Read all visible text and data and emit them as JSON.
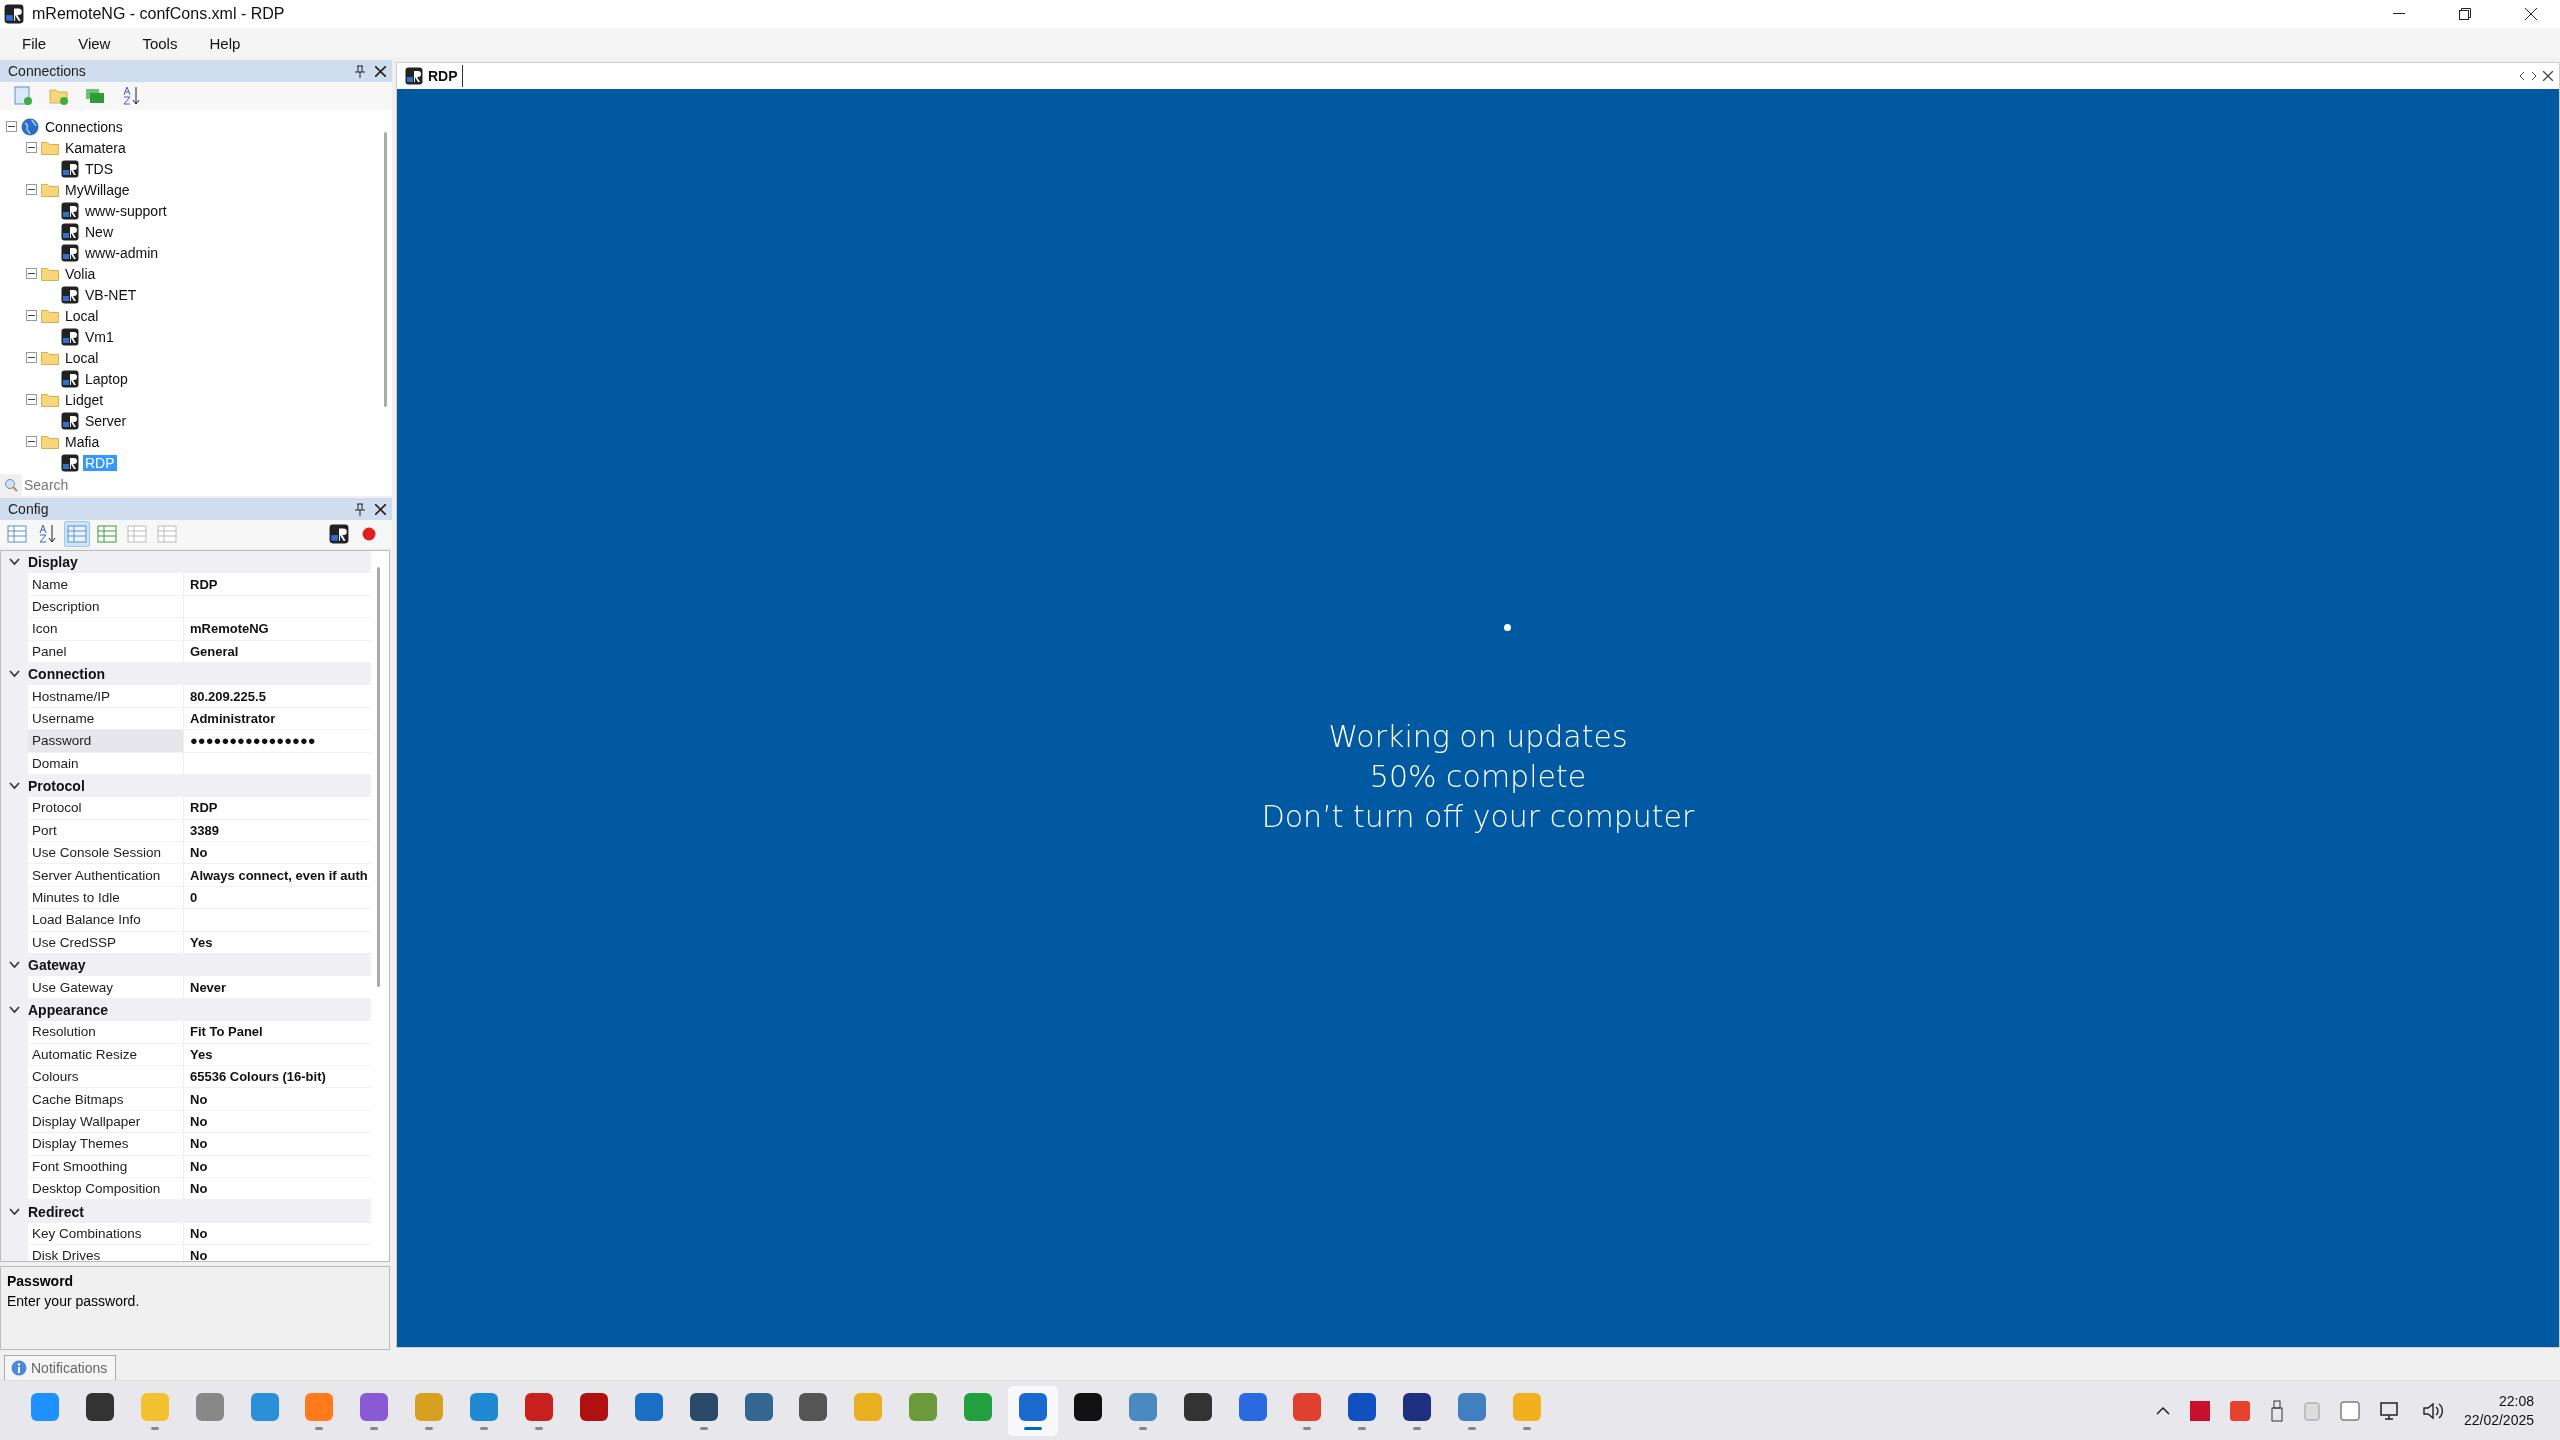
{
  "window": {
    "title": "mRemoteNG - confCons.xml - RDP"
  },
  "menu": [
    "File",
    "View",
    "Tools",
    "Help"
  ],
  "connections_panel": {
    "title": "Connections",
    "search_placeholder": "Search",
    "tree": [
      {
        "label": "Connections",
        "kind": "root",
        "expanded": true,
        "selected": false,
        "children": [
          {
            "label": "Kamatera",
            "kind": "folder",
            "expanded": true,
            "selected": false,
            "children": [
              {
                "label": "TDS",
                "kind": "connection",
                "selected": false
              }
            ]
          },
          {
            "label": "MyWillage",
            "kind": "folder",
            "expanded": true,
            "selected": false,
            "children": [
              {
                "label": "www-support",
                "kind": "connection",
                "selected": false
              },
              {
                "label": "New",
                "kind": "connection",
                "selected": false
              },
              {
                "label": "www-admin",
                "kind": "connection",
                "selected": false
              }
            ]
          },
          {
            "label": "Volia",
            "kind": "folder",
            "expanded": true,
            "selected": false,
            "children": [
              {
                "label": "VB-NET",
                "kind": "connection",
                "selected": false
              }
            ]
          },
          {
            "label": "Local",
            "kind": "folder",
            "expanded": true,
            "selected": false,
            "children": [
              {
                "label": "Vm1",
                "kind": "connection",
                "selected": false
              }
            ]
          },
          {
            "label": "Local",
            "kind": "folder",
            "expanded": true,
            "selected": false,
            "children": [
              {
                "label": "Laptop",
                "kind": "connection",
                "selected": false
              }
            ]
          },
          {
            "label": "Lidget",
            "kind": "folder",
            "expanded": true,
            "selected": false,
            "children": [
              {
                "label": "Server",
                "kind": "connection",
                "selected": false
              }
            ]
          },
          {
            "label": "Mafia",
            "kind": "folder",
            "expanded": true,
            "selected": false,
            "children": [
              {
                "label": "RDP",
                "kind": "connection",
                "selected": true
              }
            ]
          }
        ]
      }
    ]
  },
  "config_panel": {
    "title": "Config",
    "toolbar": [
      {
        "selected": false,
        "disabled": false
      },
      {
        "selected": false,
        "disabled": false
      },
      {
        "selected": true,
        "disabled": false
      },
      {
        "selected": false,
        "disabled": false
      },
      {
        "selected": false,
        "disabled": true
      },
      {
        "selected": false,
        "disabled": true
      }
    ],
    "categories": [
      {
        "name": "Display",
        "expanded": true,
        "properties": [
          {
            "name": "Name",
            "value": "RDP",
            "selected": false
          },
          {
            "name": "Description",
            "selected": false
          },
          {
            "name": "Icon",
            "value": "mRemoteNG",
            "selected": false
          },
          {
            "name": "Panel",
            "value": "General",
            "selected": false
          }
        ]
      },
      {
        "name": "Connection",
        "expanded": true,
        "properties": [
          {
            "name": "Hostname/IP",
            "value": "80.209.225.5",
            "selected": false
          },
          {
            "name": "Username",
            "value": "Administrator",
            "selected": false
          },
          {
            "name": "Password",
            "value": "●●●●●●●●●●●●●●●●",
            "selected": true
          },
          {
            "name": "Domain",
            "selected": false
          }
        ]
      },
      {
        "name": "Protocol",
        "expanded": true,
        "properties": [
          {
            "name": "Protocol",
            "value": "RDP",
            "selected": false
          },
          {
            "name": "Port",
            "value": "3389",
            "selected": false
          },
          {
            "name": "Use Console Session",
            "value": "No",
            "selected": false
          },
          {
            "name": "Server Authentication",
            "value": "Always connect, even if auth",
            "selected": false
          },
          {
            "name": "Minutes to Idle",
            "value": "0",
            "selected": false
          },
          {
            "name": "Load Balance Info",
            "selected": false
          },
          {
            "name": "Use CredSSP",
            "value": "Yes",
            "selected": false
          }
        ]
      },
      {
        "name": "Gateway",
        "expanded": true,
        "properties": [
          {
            "name": "Use Gateway",
            "value": "Never",
            "selected": false
          }
        ]
      },
      {
        "name": "Appearance",
        "expanded": true,
        "properties": [
          {
            "name": "Resolution",
            "value": "Fit To Panel",
            "selected": false
          },
          {
            "name": "Automatic Resize",
            "value": "Yes",
            "selected": false
          },
          {
            "name": "Colours",
            "value": "65536 Colours (16-bit)",
            "selected": false
          },
          {
            "name": "Cache Bitmaps",
            "value": "No",
            "selected": false
          },
          {
            "name": "Display Wallpaper",
            "value": "No",
            "selected": false
          },
          {
            "name": "Display Themes",
            "value": "No",
            "selected": false
          },
          {
            "name": "Font Smoothing",
            "value": "No",
            "selected": false
          },
          {
            "name": "Desktop Composition",
            "value": "No",
            "selected": false
          }
        ]
      },
      {
        "name": "Redirect",
        "expanded": true,
        "properties": [
          {
            "name": "Key Combinations",
            "value": "No",
            "selected": false
          },
          {
            "name": "Disk Drives",
            "value": "No",
            "selected": false
          }
        ]
      }
    ],
    "help": {
      "title": "Password",
      "text": "Enter your password."
    }
  },
  "notifications_tab": {
    "label": "Notifications"
  },
  "document_tabs": [
    {
      "label": "RDP",
      "selected": true
    }
  ],
  "remote_screen": {
    "lines": [
      "Working on updates",
      "50% complete",
      "Don’t turn off your computer"
    ]
  },
  "taskbar": {
    "apps": [
      {
        "running": false,
        "selected": false
      },
      {
        "running": false,
        "selected": false
      },
      {
        "running": true,
        "selected": false
      },
      {
        "running": false,
        "selected": false
      },
      {
        "running": false,
        "selected": false
      },
      {
        "running": true,
        "selected": false
      },
      {
        "running": true,
        "selected": false
      },
      {
        "running": true,
        "selected": false
      },
      {
        "running": true,
        "selected": false
      },
      {
        "running": true,
        "selected": false
      },
      {
        "running": false,
        "selected": false
      },
      {
        "running": false,
        "selected": false
      },
      {
        "running": true,
        "selected": false
      },
      {
        "running": false,
        "selected": false
      },
      {
        "running": false,
        "selected": false
      },
      {
        "running": false,
        "selected": false
      },
      {
        "running": false,
        "selected": false
      },
      {
        "running": false,
        "selected": false
      },
      {
        "running": true,
        "selected": true
      },
      {
        "running": false,
        "selected": false
      },
      {
        "running": true,
        "selected": false
      },
      {
        "running": false,
        "selected": false
      },
      {
        "running": false,
        "selected": false
      },
      {
        "running": true,
        "selected": false
      },
      {
        "running": true,
        "selected": false
      },
      {
        "running": true,
        "selected": false
      },
      {
        "running": true,
        "selected": false
      },
      {
        "running": true,
        "selected": false
      }
    ],
    "time": "22:08",
    "date": "22/02/2025"
  }
}
